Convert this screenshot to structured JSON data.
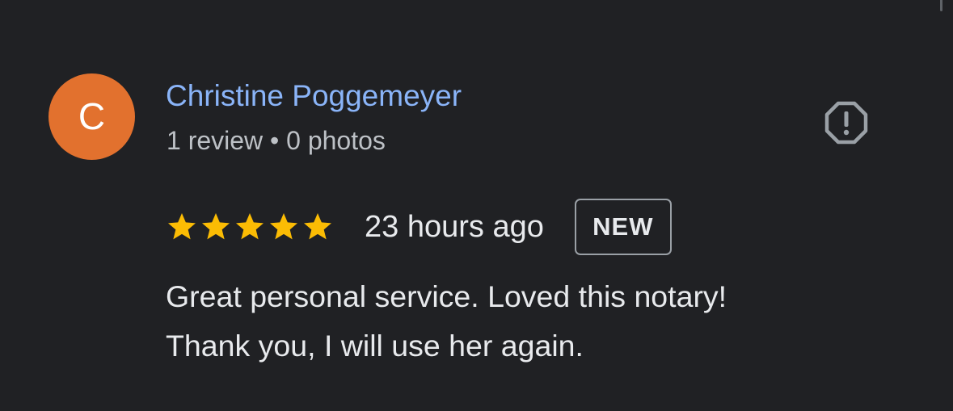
{
  "review": {
    "author": {
      "initial": "C",
      "name": "Christine Poggemeyer",
      "meta": "1 review • 0 photos",
      "avatar_color": "#e2712e"
    },
    "rating": {
      "stars": 5,
      "max_stars": 5,
      "star_color": "#fbbc04"
    },
    "time": "23 hours ago",
    "badge": "NEW",
    "text_lines": [
      "Great personal service. Loved this notary!",
      "Thank you, I will use her again."
    ],
    "icons": {
      "report": "report-icon",
      "star": "star-icon"
    },
    "colors": {
      "background": "#202124",
      "name_link": "#8ab4f8"
    }
  }
}
